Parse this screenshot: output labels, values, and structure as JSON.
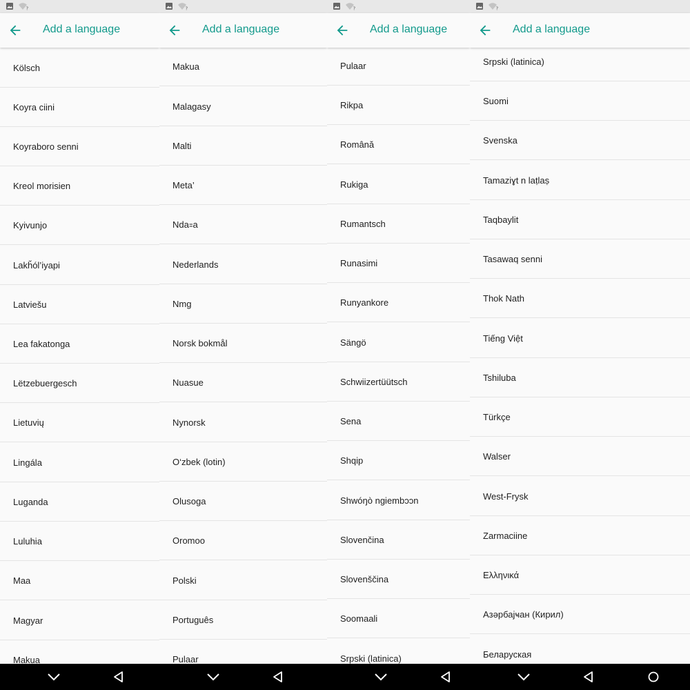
{
  "app_bar": {
    "title": "Add a language"
  },
  "colors": {
    "accent": "#139a8c",
    "status_bar": "#e8e8e8",
    "nav_bar": "#000000",
    "text": "#212121",
    "divider": "#e4e4e4"
  },
  "icons": {
    "back": "arrow-left-icon",
    "nav_down": "chevron-down-icon",
    "nav_back": "triangle-back-icon",
    "nav_home": "circle-home-icon"
  },
  "panels": [
    {
      "items": [
        "Kölsch",
        "Koyra ciini",
        "Koyraboro senni",
        "Kreol morisien",
        "Kyivunjo",
        "Lakȟól’iyapi",
        "Latviešu",
        "Lea fakatonga",
        "Lëtzebuergesch",
        "Lietuvių",
        "Lingála",
        "Luganda",
        "Luluhia",
        "Maa",
        "Magyar",
        "Makua"
      ]
    },
    {
      "items": [
        "Makua",
        "Malagasy",
        "Malti",
        "Meta’",
        "Nda꞊a",
        "Nederlands",
        "Nmg",
        "Norsk bokmål",
        "Nuasue",
        "Nynorsk",
        "O‘zbek (lotin)",
        "Olusoga",
        "Oromoo",
        "Polski",
        "Português",
        "Pulaar"
      ]
    },
    {
      "items": [
        "Pulaar",
        "Rikpa",
        "Română",
        "Rukiga",
        "Rumantsch",
        "Runasimi",
        "Runyankore",
        "Sängö",
        "Schwiizertüütsch",
        "Sena",
        "Shqip",
        "Shwóŋò ngiembɔɔn",
        "Slovenčina",
        "Slovenščina",
        "Soomaali",
        "Srpski (latinica)"
      ]
    },
    {
      "items": [
        "Srpski (latinica)",
        "Suomi",
        "Svenska",
        "Tamaziɣt n laṭlaṣ",
        "Taqbaylit",
        "Tasawaq senni",
        "Thok Nath",
        "Tiếng Việt",
        "Tshiluba",
        "Türkçe",
        "Walser",
        "West-Frysk",
        "Zarmaciine",
        "Ελληνικά",
        "Азәрбајҹан (Кирил)",
        "Беларуская"
      ]
    }
  ]
}
